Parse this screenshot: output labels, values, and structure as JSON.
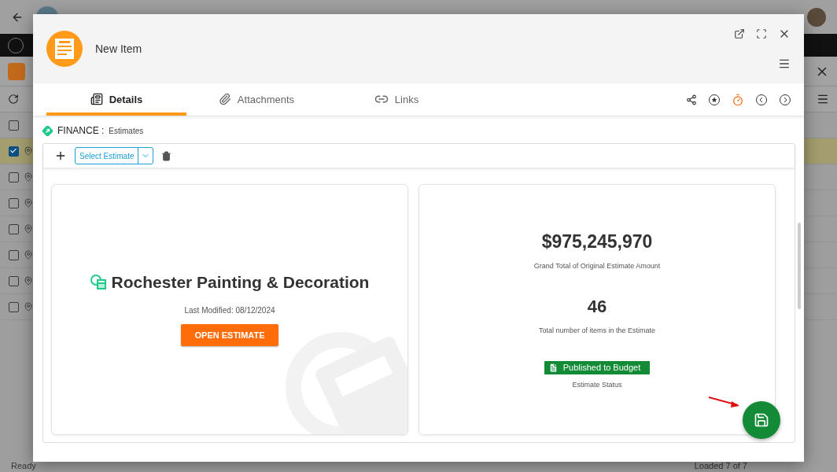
{
  "background": {
    "rows": [
      {
        "checked": true
      },
      {
        "checked": false
      },
      {
        "checked": false
      },
      {
        "checked": false
      },
      {
        "checked": false
      },
      {
        "checked": false
      },
      {
        "checked": false
      }
    ],
    "header_checkbox": {
      "checked": false
    },
    "status_bar": {
      "status": "Ready",
      "loaded": "Loaded 7 of 7"
    }
  },
  "window": {
    "title": "New Item"
  },
  "tabs": [
    {
      "label": "Details",
      "kind": "details",
      "selected": true
    },
    {
      "label": "Attachments",
      "kind": "attachments",
      "selected": false
    },
    {
      "label": "Links",
      "kind": "links",
      "selected": false
    }
  ],
  "breadcrumb": {
    "module": "FINANCE :",
    "section": "Estimates"
  },
  "toolbar": {
    "select": "Select Estimate"
  },
  "estimate": {
    "title": "Rochester Painting & Decoration",
    "modified": "Last Modified: 08/12/2024",
    "button": "OPEN ESTIMATE"
  },
  "stats": [
    {
      "value": "$975,245,970",
      "label": "Grand Total of Original Estimate Amount"
    },
    {
      "value": "46",
      "label": "Total number of items in the Estimate"
    }
  ],
  "status": {
    "badge": "Published to Budget",
    "color": "#138a36",
    "label": "Estimate Status"
  }
}
